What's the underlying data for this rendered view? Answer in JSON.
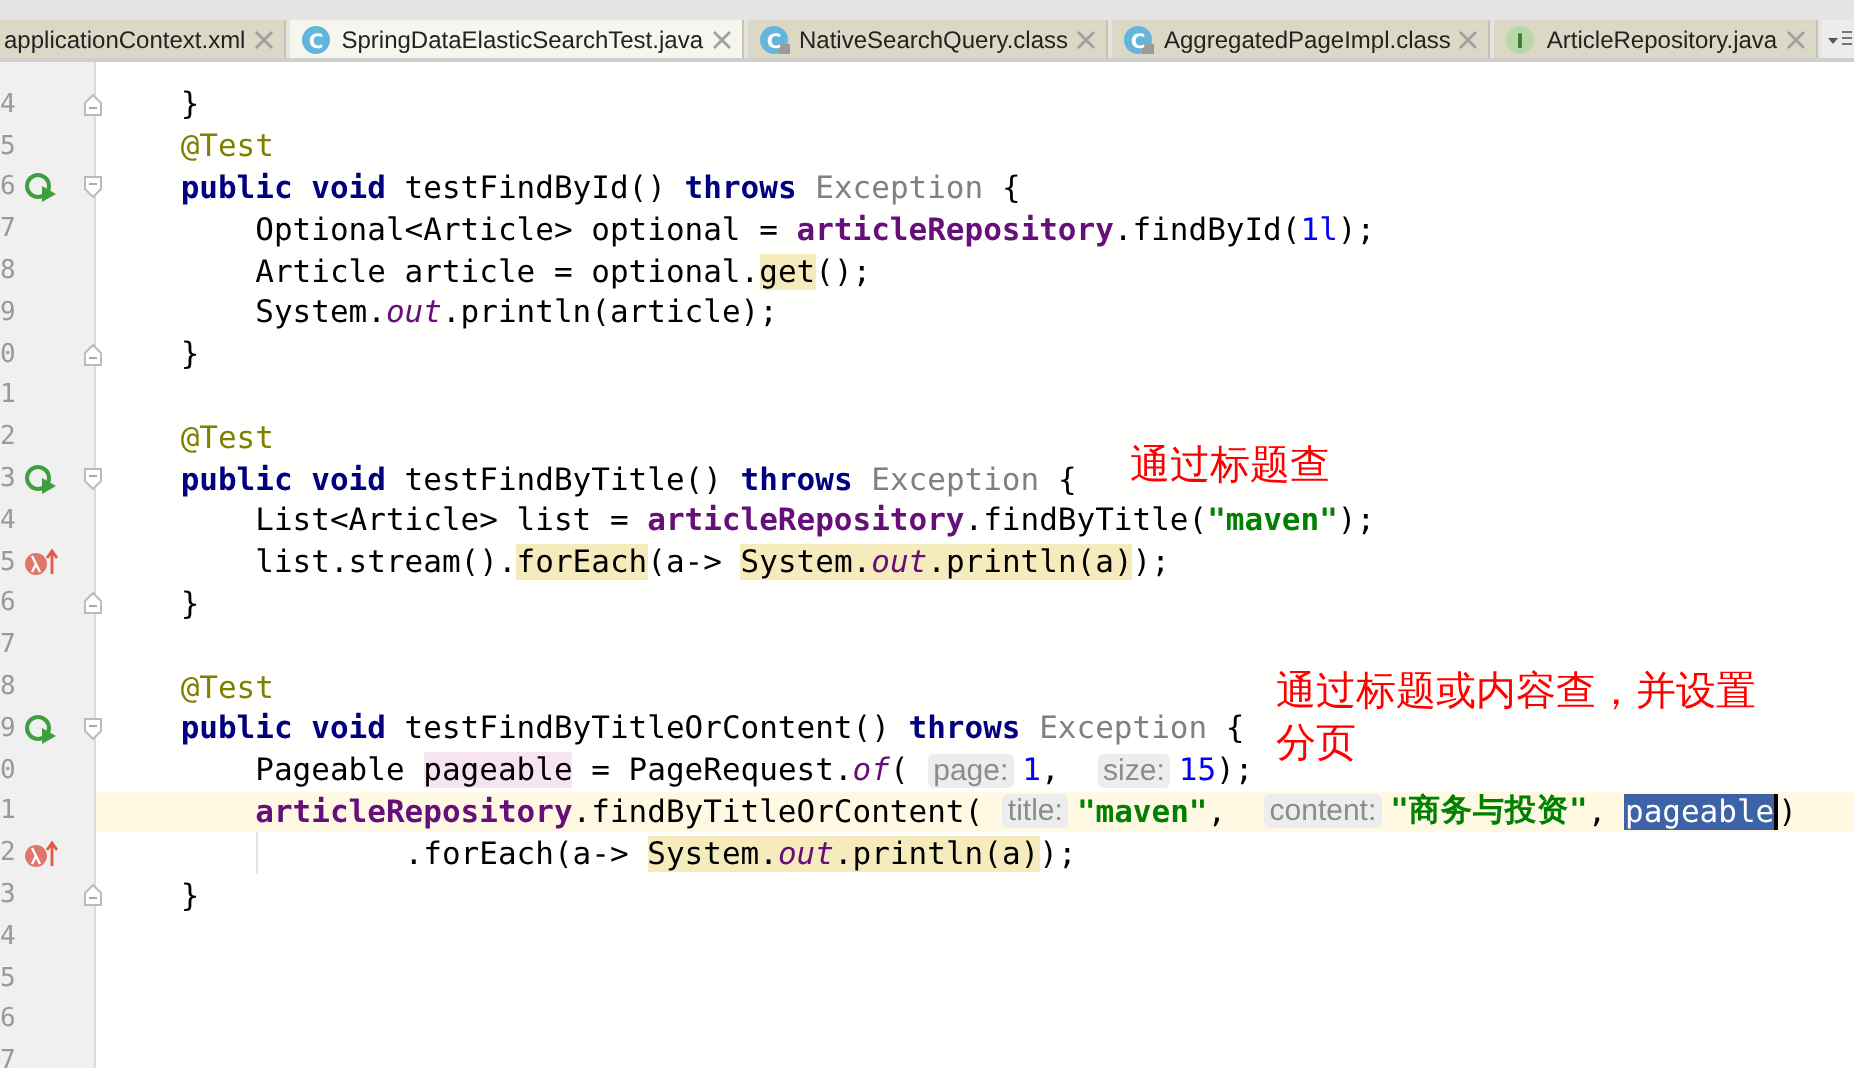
{
  "tabs": [
    {
      "label": "applicationContext.xml",
      "selected": false
    },
    {
      "label": "SpringDataElasticSearchTest.java",
      "selected": true,
      "kind": "class",
      "icon_letter": "C"
    },
    {
      "label": "NativeSearchQuery.class",
      "selected": false,
      "kind": "compiled",
      "icon_letter": "C"
    },
    {
      "label": "AggregatedPageImpl.class",
      "selected": false,
      "kind": "compiled",
      "icon_letter": "C"
    },
    {
      "label": "ArticleRepository.java",
      "selected": false,
      "kind": "interface",
      "icon_letter": "I"
    }
  ],
  "lines": [
    {
      "num": "4",
      "kind": "end",
      "tokens": [
        {
          "t": "}",
          "kind": "text"
        }
      ]
    },
    {
      "num": "5",
      "tokens": [
        {
          "t": "@Test",
          "kind": "ann"
        }
      ]
    },
    {
      "num": "6",
      "kind": "method",
      "tokens": [
        {
          "t": "public void",
          "kind": "kw"
        },
        {
          "t": " testFindById() ",
          "kind": "text"
        },
        {
          "t": "throws",
          "kind": "kw"
        },
        {
          "t": " Exception",
          "kind": "muted"
        },
        {
          "t": " {",
          "kind": "text"
        }
      ],
      "children": [
        {
          "num": "7",
          "tokens": [
            {
              "t": "Optional<Article> optional = ",
              "kind": "text"
            },
            {
              "t": "articleRepository",
              "kind": "field"
            },
            {
              "t": ".findById(",
              "kind": "text"
            },
            {
              "t": "1l",
              "kind": "num"
            },
            {
              "t": ");",
              "kind": "text"
            }
          ]
        },
        {
          "num": "8",
          "tokens": [
            {
              "t": "Article article = optional.",
              "kind": "text"
            },
            {
              "t": "get",
              "kind": "usage"
            },
            {
              "t": "();",
              "kind": "text"
            }
          ]
        },
        {
          "num": "9",
          "tokens": [
            {
              "t": "System.",
              "kind": "text"
            },
            {
              "t": "out",
              "kind": "static"
            },
            {
              "t": ".println(article);",
              "kind": "text"
            }
          ]
        }
      ]
    },
    {
      "num": "0",
      "kind": "end",
      "tokens": [
        {
          "t": "}",
          "kind": "text"
        }
      ]
    },
    {
      "num": "1"
    },
    {
      "num": "2",
      "tokens": [
        {
          "t": "@Test",
          "kind": "ann"
        }
      ]
    },
    {
      "num": "3",
      "kind": "method",
      "note": "通过标题查",
      "tokens": [
        {
          "t": "public void",
          "kind": "kw"
        },
        {
          "t": " testFindByTitle() ",
          "kind": "text"
        },
        {
          "t": "throws",
          "kind": "kw"
        },
        {
          "t": " Exception",
          "kind": "muted"
        },
        {
          "t": " {",
          "kind": "text"
        }
      ],
      "children": [
        {
          "num": "4",
          "tokens": [
            {
              "t": "List<Article> list = ",
              "kind": "text"
            },
            {
              "t": "articleRepository",
              "kind": "field"
            },
            {
              "t": ".findByTitle(",
              "kind": "text"
            },
            {
              "t": "\"maven\"",
              "kind": "str"
            },
            {
              "t": ");",
              "kind": "text"
            }
          ]
        },
        {
          "num": "5",
          "kind": "lambda",
          "tokens": [
            {
              "t": "list.stream().",
              "kind": "text"
            },
            {
              "t": "forEach",
              "kind": "usage"
            },
            {
              "t": "(a-> ",
              "kind": "text"
            },
            {
              "t": "System.",
              "kind": "usage"
            },
            {
              "t": "out",
              "kind": "usage-static"
            },
            {
              "t": ".println(a)",
              "kind": "usage"
            },
            {
              "t": ");",
              "kind": "text"
            }
          ]
        }
      ]
    },
    {
      "num": "6",
      "kind": "end",
      "tokens": [
        {
          "t": "}",
          "kind": "text"
        }
      ]
    },
    {
      "num": "7"
    },
    {
      "num": "8",
      "tokens": [
        {
          "t": "@Test",
          "kind": "ann"
        }
      ]
    },
    {
      "num": "9",
      "kind": "method",
      "note": "通过标题或内容查，并设置分页",
      "tokens": [
        {
          "t": "public void",
          "kind": "kw"
        },
        {
          "t": " testFindByTitleOrContent() ",
          "kind": "text"
        },
        {
          "t": "throws",
          "kind": "kw"
        },
        {
          "t": " Exception",
          "kind": "muted"
        },
        {
          "t": " {",
          "kind": "text"
        }
      ],
      "children": [
        {
          "num": "0",
          "tokens": [
            {
              "t": "Pageable ",
              "kind": "text"
            },
            {
              "t": "pageable",
              "kind": "write"
            },
            {
              "t": " = PageRequest.",
              "kind": "text"
            },
            {
              "t": "of",
              "kind": "static"
            },
            {
              "t": "( ",
              "kind": "text"
            },
            {
              "t": "page:",
              "kind": "hint"
            },
            {
              "t": "1",
              "kind": "num"
            },
            {
              "t": ",  ",
              "kind": "text"
            },
            {
              "t": "size:",
              "kind": "hint"
            },
            {
              "t": "15",
              "kind": "num"
            },
            {
              "t": ");",
              "kind": "text"
            }
          ]
        },
        {
          "num": "1",
          "current": true,
          "tokens": [
            {
              "t": "articleRepository",
              "kind": "field"
            },
            {
              "t": ".findByTitleOrContent( ",
              "kind": "text"
            },
            {
              "t": "title:",
              "kind": "hint"
            },
            {
              "t": "\"maven\"",
              "kind": "str"
            },
            {
              "t": ",  ",
              "kind": "text"
            },
            {
              "t": "content:",
              "kind": "hint"
            },
            {
              "t": "\"商务与投资\"",
              "kind": "str"
            },
            {
              "t": ", ",
              "kind": "text"
            },
            {
              "t": "pageable",
              "kind": "selected"
            },
            {
              "t": ")",
              "kind": "text"
            }
          ],
          "children": [
            {
              "num": "2",
              "kind": "lambda",
              "tokens": [
                {
                  "t": ".forEach(a-> ",
                  "kind": "text"
                },
                {
                  "t": "System.",
                  "kind": "usage"
                },
                {
                  "t": "out",
                  "kind": "usage-static"
                },
                {
                  "t": ".println(a)",
                  "kind": "usage"
                },
                {
                  "t": ");",
                  "kind": "text"
                }
              ]
            }
          ]
        }
      ]
    },
    {
      "num": "3",
      "kind": "end",
      "tokens": [
        {
          "t": "}",
          "kind": "text"
        }
      ]
    },
    {
      "num": "4"
    },
    {
      "num": "5"
    },
    {
      "num": "6"
    },
    {
      "num": "7"
    }
  ]
}
